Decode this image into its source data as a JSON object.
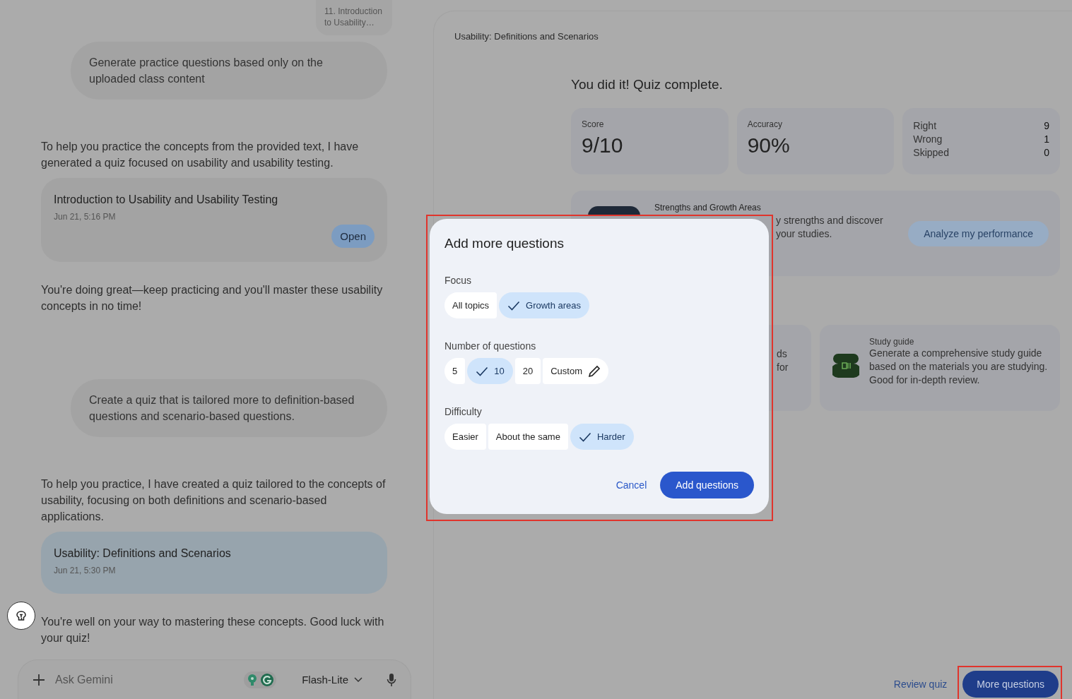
{
  "chat": {
    "attachment": "11. Introduction to Usability…",
    "messages": [
      {
        "kind": "user",
        "text": "Generate practice questions based only on the uploaded class content"
      },
      {
        "kind": "model",
        "text": "To help you practice the concepts from the provided text, I have generated a quiz focused on usability and usability testing."
      },
      {
        "kind": "quiz",
        "title": "Introduction to Usability and Usability Testing",
        "date": "Jun 21, 5:16 PM",
        "button": "Open",
        "selected": false
      },
      {
        "kind": "model",
        "text": "You're doing great—keep practicing and you'll master these usability concepts in no time!"
      },
      {
        "kind": "user",
        "text": "Create a quiz that is tailored more to definition-based questions and scenario-based questions."
      },
      {
        "kind": "model",
        "text": "To help you practice, I have created a quiz tailored to the concepts of usability, focusing on both definitions and scenario-based applications."
      },
      {
        "kind": "quiz",
        "title": "Usability: Definitions and Scenarios",
        "date": "Jun 21, 5:30 PM",
        "selected": true
      },
      {
        "kind": "model",
        "text": "You're well on your way to mastering these concepts. Good luck with your quiz!"
      }
    ],
    "input": {
      "placeholder": "Ask Gemini",
      "model": "Flash-Lite"
    }
  },
  "panel": {
    "title": "Usability: Definitions and Scenarios",
    "heading": "You did it! Quiz complete.",
    "stats": [
      {
        "kind": "single",
        "label": "Score",
        "value": "9/10"
      },
      {
        "kind": "single",
        "label": "Accuracy",
        "value": "90%"
      },
      {
        "kind": "breakdown",
        "rows": [
          {
            "label": "Right",
            "value": "9"
          },
          {
            "label": "Wrong",
            "value": "1"
          },
          {
            "label": "Skipped",
            "value": "0"
          }
        ]
      }
    ],
    "strengths": {
      "title": "Strengths and Growth Areas",
      "lines": [
        "y strengths and discover",
        "your studies."
      ],
      "button": "Analyze my performance"
    },
    "tools": [
      {
        "kind": "partial",
        "lines": [
          "ds",
          "for"
        ]
      },
      {
        "kind": "full",
        "title": "Study guide",
        "description": "Generate a comprehensive study guide based on the materials you are studying. Good for in-depth review."
      }
    ],
    "actions": {
      "review": "Review quiz",
      "more": "More questions"
    }
  },
  "dialog": {
    "title": "Add more questions",
    "groups": [
      {
        "label": "Focus",
        "options": [
          {
            "kind": "choice",
            "label": "All topics",
            "selected": false
          },
          {
            "kind": "choice",
            "label": "Growth areas",
            "selected": true
          }
        ]
      },
      {
        "label": "Number of questions",
        "options": [
          {
            "kind": "choice",
            "label": "5",
            "selected": false
          },
          {
            "kind": "choice",
            "label": "10",
            "selected": true
          },
          {
            "kind": "choice",
            "label": "20",
            "selected": false
          },
          {
            "kind": "custom",
            "label": "Custom",
            "selected": false
          }
        ]
      },
      {
        "label": "Difficulty",
        "options": [
          {
            "kind": "choice",
            "label": "Easier",
            "selected": false
          },
          {
            "kind": "choice",
            "label": "About the same",
            "selected": false
          },
          {
            "kind": "choice",
            "label": "Harder",
            "selected": true
          }
        ]
      }
    ],
    "cancel": "Cancel",
    "confirm": "Add questions"
  }
}
